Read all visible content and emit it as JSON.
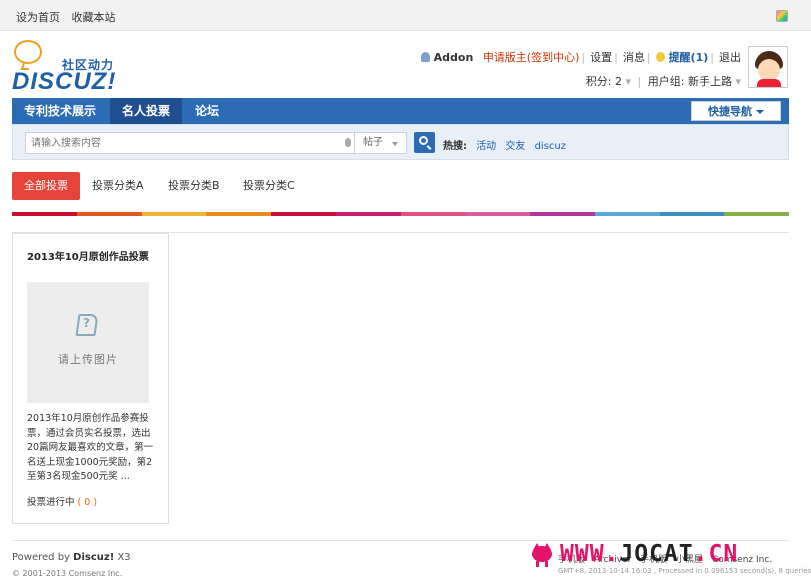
{
  "topbar": {
    "set_home": "设为首页",
    "bookmark": "收藏本站"
  },
  "logo": {
    "cn": "社区动力",
    "en": "DISCUZ!"
  },
  "user": {
    "name": "Addon",
    "apply_moderator": "申请版主(签到中心)",
    "settings": "设置",
    "messages": "消息",
    "reminders": "提醒(1)",
    "logout": "退出",
    "points": "积分: 2",
    "usergroup": "用户组: 新手上路"
  },
  "nav": {
    "items": [
      {
        "label": "专利技术展示"
      },
      {
        "label": "名人投票"
      },
      {
        "label": "论坛"
      }
    ],
    "active": "名人投票",
    "quick_nav": "快捷导航"
  },
  "search": {
    "placeholder": "请输入搜索内容",
    "type": "帖子",
    "hot_label": "热搜:",
    "hot_items": [
      "活动",
      "交友",
      "discuz"
    ]
  },
  "tabs": [
    "全部投票",
    "投票分类A",
    "投票分类B",
    "投票分类C"
  ],
  "rainbow_colors": [
    "#c8102e",
    "#e15a1f",
    "#f0b43c",
    "#e88a1c",
    "#c8103c",
    "#c8206e",
    "#e05080",
    "#d85ca0",
    "#b03a9c",
    "#5aa8d8",
    "#3c8cc8",
    "#88b048"
  ],
  "card": {
    "title": "2013年10月原创作品投票",
    "upload": "请上传图片",
    "description": "2013年10月原创作品参赛投票，通过会员实名投票，选出20篇网友最喜欢的文章，第一名送上现金1000元奖励，第2至第3名现金500元奖 ...",
    "status_label": "投票进行中",
    "status_count": "( 0 )"
  },
  "footer": {
    "powered_by": "Powered by",
    "brand": "Discuz!",
    "version": "X3",
    "copyright": "© 2001-2013 Comsenz Inc.",
    "links": [
      "手机版",
      "Archiver",
      "手机版",
      "小黑屋",
      "Comsenz Inc."
    ],
    "meta": "GMT+8, 2013-10-14 16:03 , Processed in 0.096153 second(s), 8 queries ."
  },
  "watermark": {
    "prefix": "WWW.",
    "middle": "JOCAT",
    "suffix": ".CN"
  }
}
